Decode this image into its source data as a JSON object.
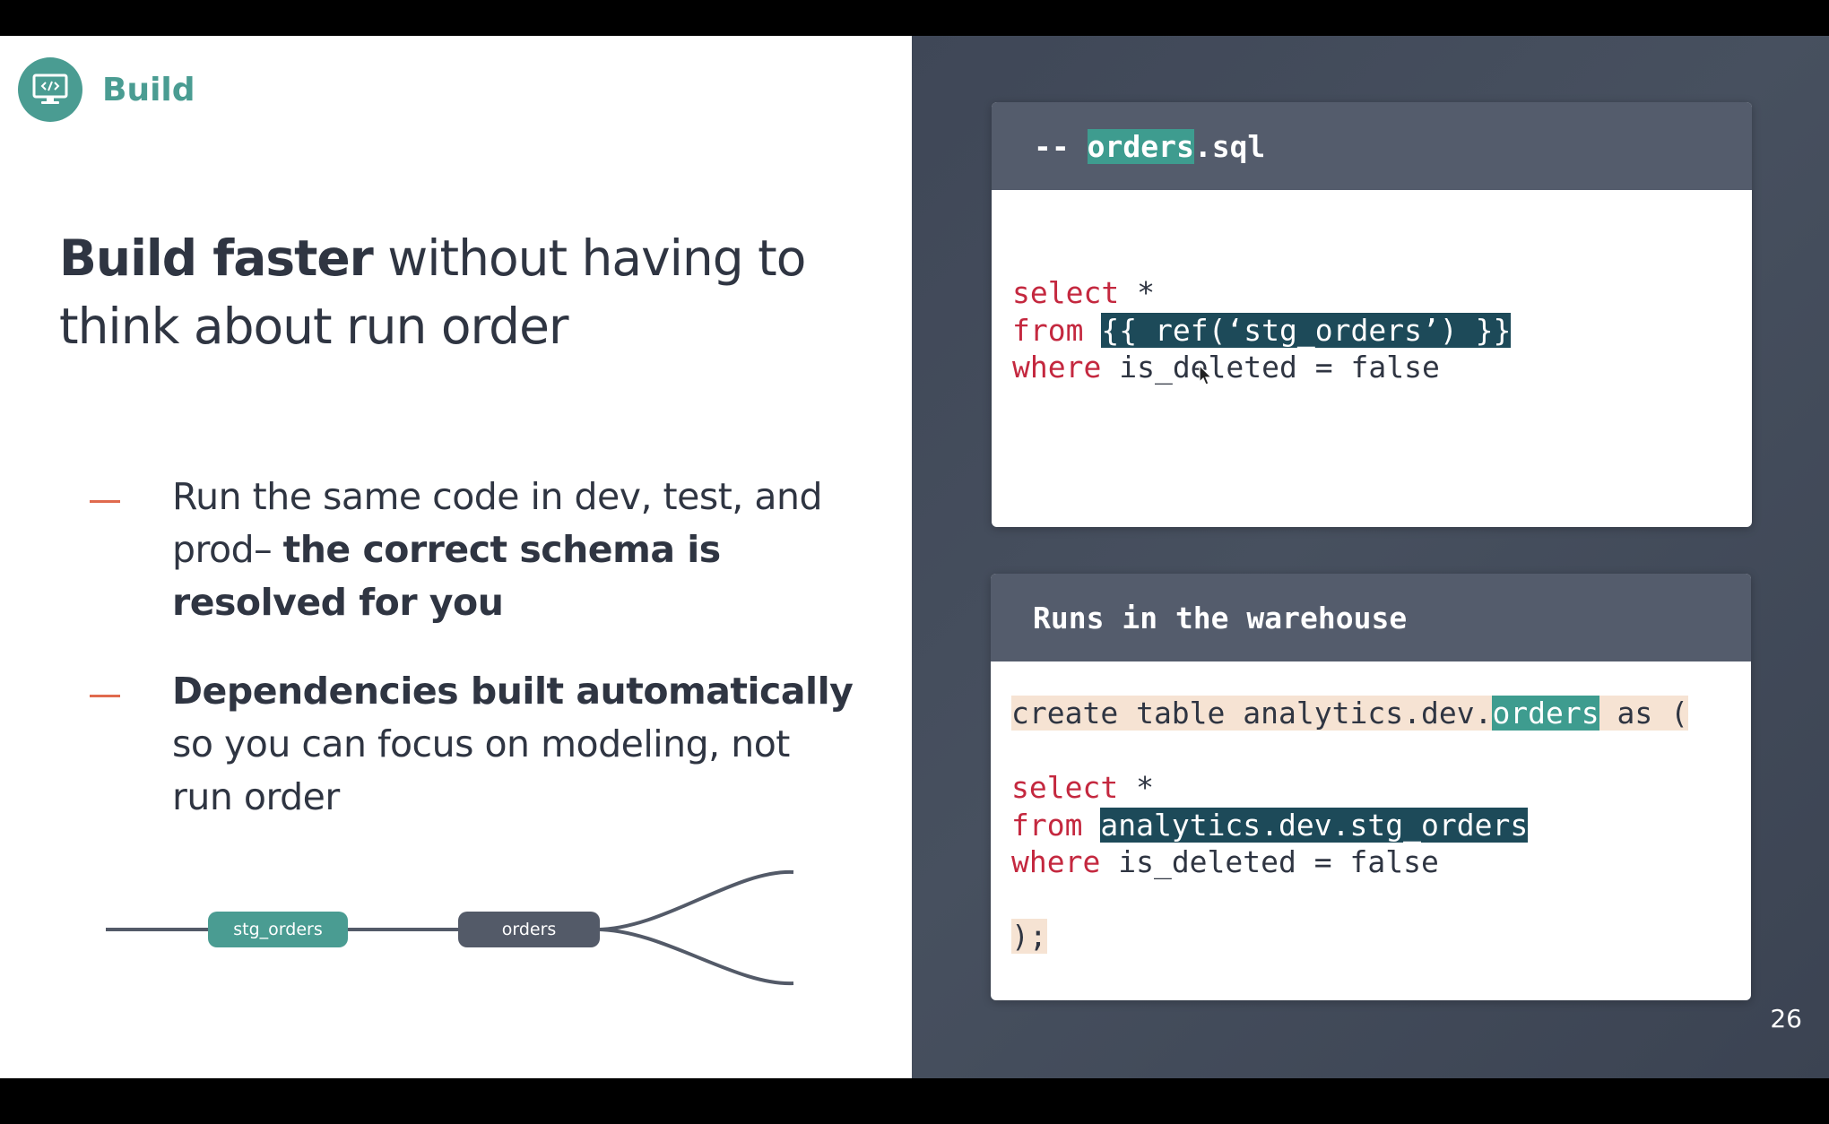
{
  "section": {
    "title": "Build",
    "icon": "code-monitor-icon"
  },
  "heading": {
    "bold": "Build faster",
    "rest": " without having to think about run order"
  },
  "bullets": [
    {
      "text": "Run the same code in dev, test, and prod– ",
      "bold": "the correct schema is resolved for you"
    },
    {
      "bold": "Dependencies built automatically",
      "text": " so you can focus on modeling, not run order"
    }
  ],
  "dag": {
    "nodes": [
      "stg_orders",
      "orders"
    ]
  },
  "source_card": {
    "header_prefix": "-- ",
    "header_highlight": "orders",
    "header_suffix": ".sql",
    "line1_kw": "select",
    "line1_rest": " *",
    "line2_kw": "from",
    "line2_hl": "{{ ref(‘stg_orders’) }}",
    "line3_kw": "where",
    "line3_rest": " is_deleted = false"
  },
  "compiled_card": {
    "header": "Runs in the warehouse",
    "create_prefix": "create table analytics.dev.",
    "create_hl": "orders",
    "create_suffix": " as (",
    "line1_kw": "select",
    "line1_rest": " *",
    "line2_kw": "from",
    "line2_hl": "analytics.dev.stg_orders",
    "line3_kw": "where",
    "line3_rest": " is_deleted = false",
    "close": ");"
  },
  "page_number": "26",
  "colors": {
    "accent_teal": "#4a9c92",
    "bullet_dash": "#e06a4e",
    "keyword": "#c4283f",
    "highlight_dark": "#1d4a59",
    "panel_dark": "#434b5a"
  }
}
